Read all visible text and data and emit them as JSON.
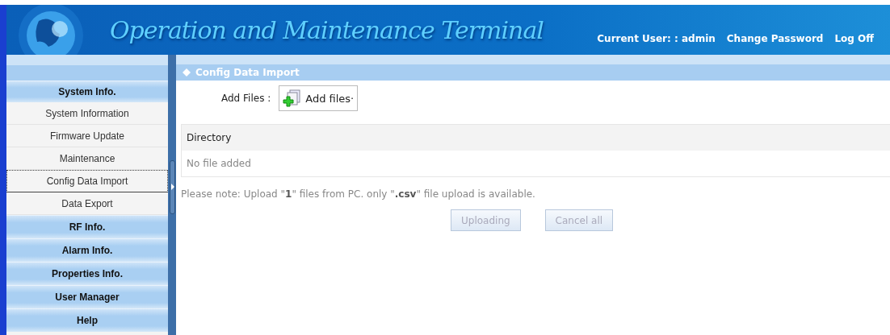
{
  "header": {
    "title": "Operation and Maintenance Terminal",
    "user_label": "Current User: : admin",
    "links": [
      "Change Password",
      "Log Off"
    ]
  },
  "sidebar": {
    "sections": [
      {
        "label": "System Info.",
        "expanded": true,
        "items": [
          {
            "label": "System Information",
            "selected": false
          },
          {
            "label": "Firmware Update",
            "selected": false
          },
          {
            "label": "Maintenance",
            "selected": false
          },
          {
            "label": "Config Data Import",
            "selected": true
          },
          {
            "label": "Data Export",
            "selected": false
          }
        ]
      },
      {
        "label": "RF Info.",
        "expanded": false
      },
      {
        "label": "Alarm Info.",
        "expanded": false
      },
      {
        "label": "Properties Info.",
        "expanded": false
      },
      {
        "label": "User Manager",
        "expanded": false
      },
      {
        "label": "Help",
        "expanded": false
      }
    ]
  },
  "panel": {
    "title": "Config Data Import",
    "add_files_label": "Add Files :",
    "add_files_button": "Add files·",
    "table": {
      "columns": [
        "Directory"
      ],
      "empty_text": "No file added"
    },
    "note": "Please note: Upload \"**1**\" files from PC. only \"**.csv**\" file upload is available.",
    "buttons": [
      {
        "label": "Uploading",
        "disabled": true
      },
      {
        "label": "Cancel all",
        "disabled": true
      }
    ]
  }
}
